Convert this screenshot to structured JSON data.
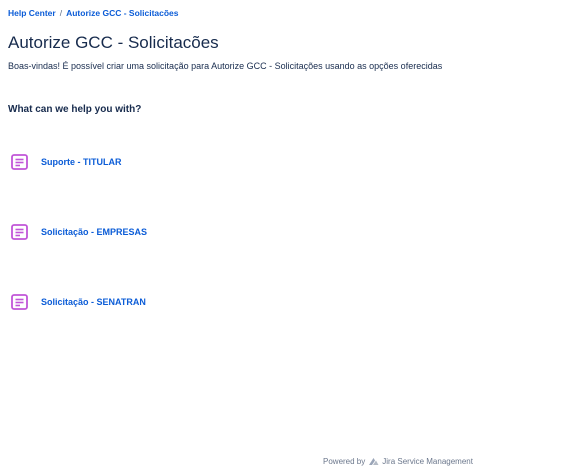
{
  "breadcrumb": {
    "items": [
      "Help Center",
      "Autorize GCC - Solicitacões"
    ],
    "separator": "/"
  },
  "page": {
    "title": "Autorize GCC - Solicitacões",
    "welcome": "Boas-vindas! É possível criar uma solicitação para Autorize GCC - Solicitações usando as opções oferecidas"
  },
  "help": {
    "heading": "What can we help you with?"
  },
  "requests": [
    {
      "label": "Suporte - TITULAR",
      "icon": "form-icon"
    },
    {
      "label": "Solicitação - EMPRESAS",
      "icon": "form-icon"
    },
    {
      "label": "Solicitação - SENATRAN",
      "icon": "form-icon"
    }
  ],
  "footer": {
    "powered_by": "Powered by",
    "product": "Jira Service Management",
    "logo": "jira-logo-icon"
  },
  "colors": {
    "link": "#0b5cd7",
    "text": "#172b4d",
    "icon": "#c156d8",
    "muted": "#6b778c"
  }
}
